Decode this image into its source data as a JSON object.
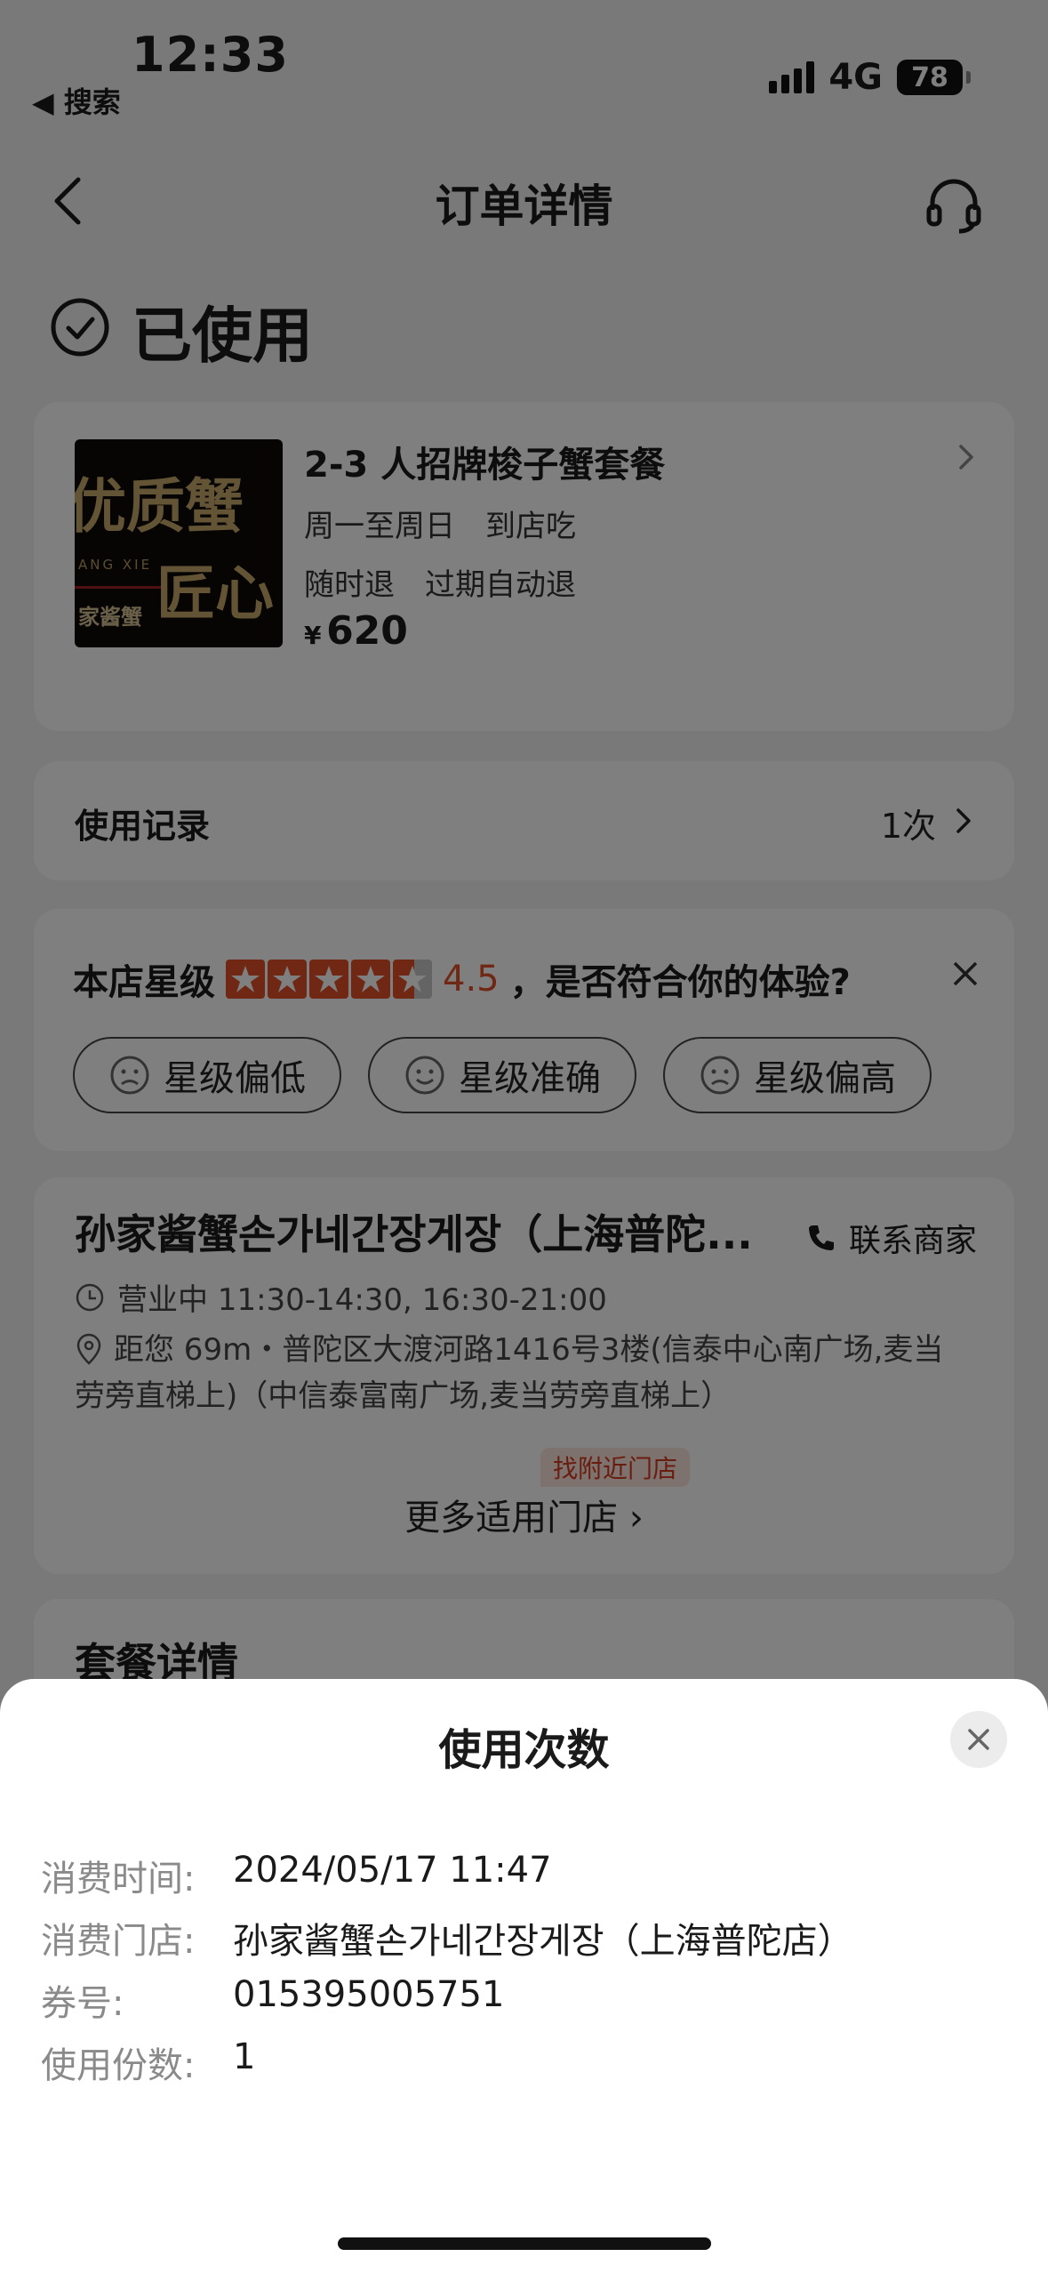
{
  "status_bar": {
    "time": "12:33",
    "back_app": "◀ 搜索",
    "network": "4G",
    "battery": "78"
  },
  "nav": {
    "title": "订单详情",
    "back_icon": "chevron-left-icon",
    "service_icon": "headset-icon"
  },
  "order_status": {
    "label": "已使用",
    "icon": "check-circle-icon"
  },
  "product": {
    "name": "2-3 人招牌梭子蟹套餐",
    "line1": "周一至周日　到店吃",
    "line2": "随时退　过期自动退",
    "currency": "¥",
    "price": "620",
    "thumb": {
      "text1": "优质蟹",
      "text2": "ANG XIE",
      "text3": "家酱蟹",
      "text4": "匠心"
    }
  },
  "usage_record": {
    "label": "使用记录",
    "count": "1次"
  },
  "rating": {
    "prefix": "本店星级",
    "score": "4.5",
    "question": "，是否符合你的体验?",
    "stars": 4.5,
    "options": [
      "星级偏低",
      "星级准确",
      "星级偏高"
    ],
    "accent_color": "#e0512a"
  },
  "store": {
    "name": "孙家酱蟹손가네간장게장（上海普陀...",
    "contact": "联系商家",
    "hours": "营业中 11:30-14:30, 16:30-21:00",
    "address": "距您 69m・普陀区大渡河路1416号3楼(信泰中心南广场,麦当劳旁直梯上)（中信泰富南广场,麦当劳旁直梯上）",
    "nearby_tag": "找附近门店",
    "more_stores": "更多适用门店 ›"
  },
  "package": {
    "title": "套餐详情"
  },
  "sheet": {
    "title": "使用次数",
    "close_icon": "close-icon",
    "details": [
      {
        "label": "消费时间:",
        "value": "2024/05/17 11:47"
      },
      {
        "label": "消费门店:",
        "value": "孙家酱蟹손가네간장게장（上海普陀店）"
      },
      {
        "label": "券号:",
        "value": "015395005751"
      },
      {
        "label": "使用份数:",
        "value": "1"
      }
    ]
  }
}
